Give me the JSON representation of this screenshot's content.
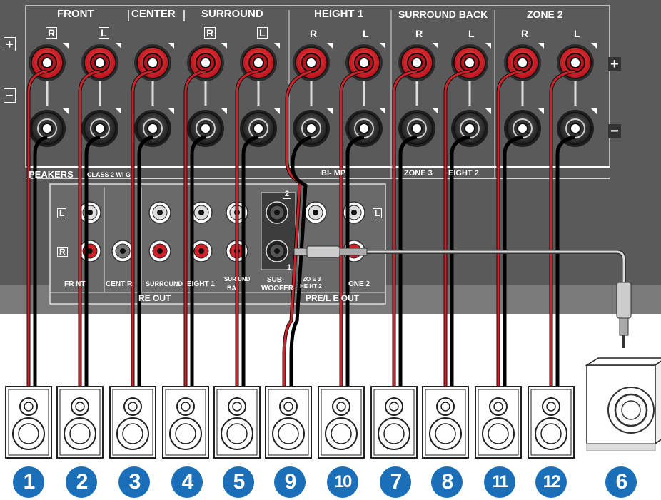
{
  "headers": {
    "front": "FRONT",
    "center": "CENTER",
    "surround": "SURROUND",
    "height1": "HEIGHT 1",
    "surround_back": "SURROUND BACK",
    "zone2": "ZONE 2"
  },
  "channel_marks": [
    "R",
    "L",
    "",
    "R",
    "L",
    "R",
    "L",
    "R",
    "L",
    "R",
    "L"
  ],
  "polarity": {
    "plus": "+",
    "minus": "−"
  },
  "strip": {
    "speakers": "PEAKERS",
    "wiring": "CLASS 2 WI  G",
    "biamp": "BI-  MP",
    "zone3": "ZONE 3",
    "height2": "EIGHT 2"
  },
  "preout": {
    "l": "L",
    "r": "R",
    "front": "FR   NT",
    "center": "CENT  R",
    "surround": "SURROUND",
    "height1": "EIGHT 1",
    "surround_back_1": "SUR  UND",
    "surround_back_2": "BA",
    "sub_1": "SUB-",
    "sub_2": "WOOFER",
    "sub_port_2": "2",
    "sub_port_1": "1",
    "zone3_1": "ZO  E 3",
    "zone3_2": "HE  HT 2",
    "zone2": "ONE 2",
    "pre_out": "RE OUT",
    "line_out": "PRE/L  E OUT"
  },
  "speaker_numbers": [
    "1",
    "2",
    "3",
    "4",
    "5",
    "9",
    "10",
    "7",
    "8",
    "11",
    "12",
    "6"
  ],
  "colors": {
    "panel": "#575757",
    "red": "#d0202a",
    "badge": "#1a6fb8"
  }
}
